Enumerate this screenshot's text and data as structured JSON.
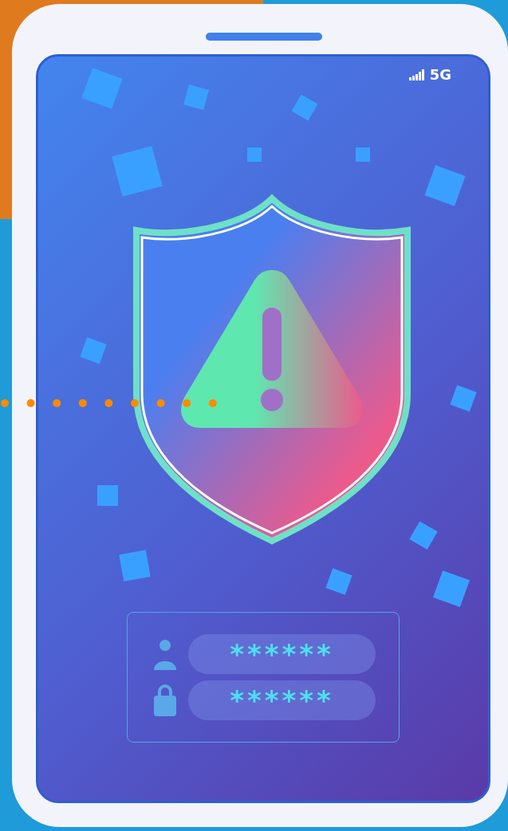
{
  "status_bar": {
    "network": "5G"
  },
  "login_form": {
    "fields": [
      {
        "kind": "user",
        "value": "******"
      },
      {
        "kind": "lock",
        "value": "******"
      }
    ]
  }
}
